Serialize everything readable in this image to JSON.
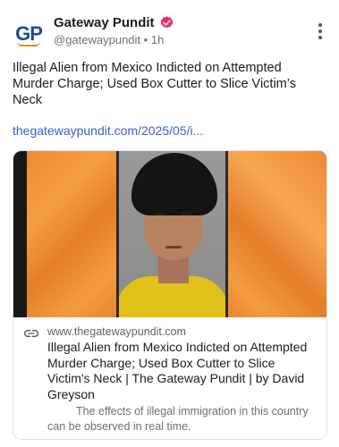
{
  "post": {
    "author_name": "Gateway Pundit",
    "handle": "@gatewaypundit",
    "separator": "•",
    "time": "1h",
    "avatar_text": "GP",
    "text": "Illegal Alien from Mexico Indicted on Attempted Murder Charge; Used Box Cutter to Slice Victim’s Neck",
    "link_text": "thegatewaypundit.com/2025/05/i..."
  },
  "card": {
    "domain": "www.thegatewaypundit.com",
    "title": "Illegal Alien from Mexico Indicted on Attempted Murder Charge; Used Box Cutter to Slice Victim's Neck | The Gateway Pundit | by David Greyson",
    "description": "The effects of illegal immigration in this country can be observed in real time."
  },
  "colors": {
    "verified_badge": "#e6336b",
    "link": "#3b5bdb",
    "background_panels": "#f09038"
  },
  "icons": {
    "verified": "verified-badge-icon",
    "menu": "more-vertical-icon",
    "link": "link-icon"
  }
}
